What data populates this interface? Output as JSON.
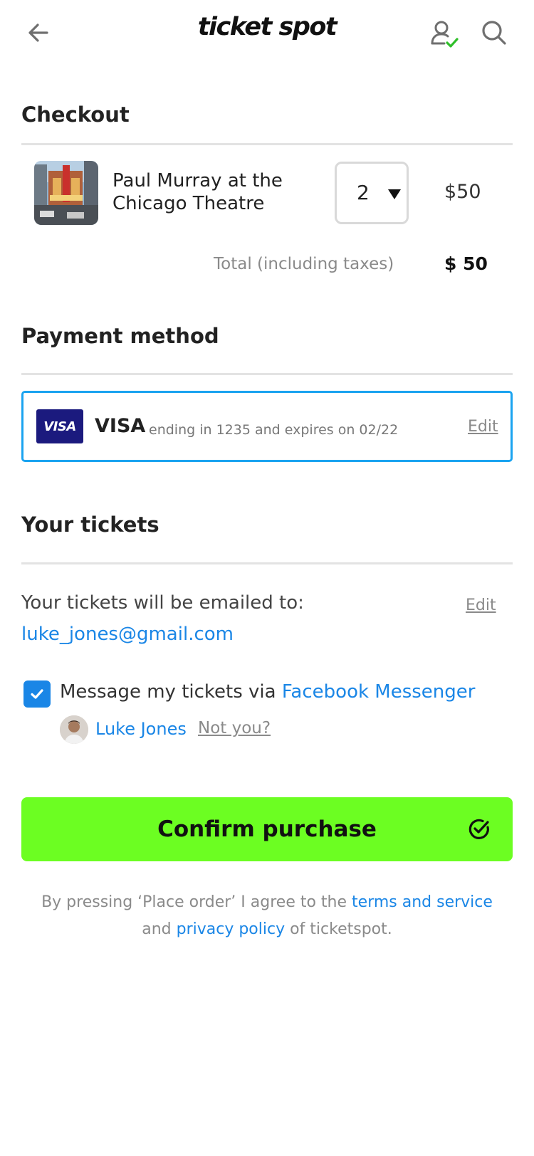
{
  "header": {
    "logo_text": "ticket spot",
    "back_icon": "arrow-left-icon",
    "user_icon": "user-verified-icon",
    "search_icon": "search-icon",
    "brand_color": "#6cfe22"
  },
  "checkout": {
    "title": "Checkout",
    "item": {
      "name": "Paul Murray at the Chicago Theatre",
      "quantity": "2",
      "price": "$50"
    },
    "total_label": "Total (including taxes)",
    "total_value": "$ 50"
  },
  "payment": {
    "title": "Payment method",
    "badge_text": "VISA",
    "brand": "VISA",
    "details": "ending in 1235 and expires on 02/22",
    "edit_label": "Edit",
    "accent_color": "#1aa3f0"
  },
  "tickets": {
    "title": "Your tickets",
    "email_label": "Your tickets will be emailed to:",
    "email": "luke_jones@gmail.com",
    "edit_label": "Edit",
    "messenger_checked": true,
    "messenger_prefix": "Message my tickets via",
    "messenger_link": "Facebook Messenger",
    "fb_user_name": "Luke Jones",
    "not_you_label": "Not you?"
  },
  "confirm": {
    "label": "Confirm purchase",
    "icon": "check-circle-icon"
  },
  "legal": {
    "text_before": "By pressing ‘Place order’ I agree to the",
    "terms_link": "terms and service",
    "text_middle": "and",
    "privacy_link": "privacy policy",
    "text_after": "of ticketspot."
  }
}
